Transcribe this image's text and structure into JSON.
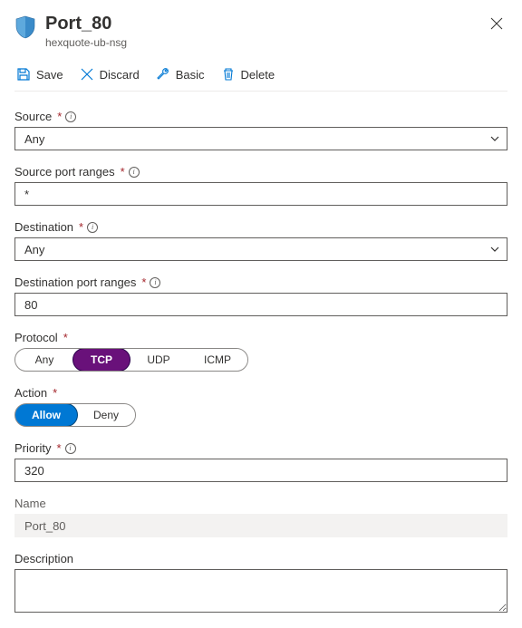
{
  "header": {
    "title": "Port_80",
    "subtitle": "hexquote-ub-nsg"
  },
  "toolbar": {
    "save": "Save",
    "discard": "Discard",
    "basic": "Basic",
    "delete": "Delete"
  },
  "labels": {
    "source": "Source",
    "source_port_ranges": "Source port ranges",
    "destination": "Destination",
    "destination_port_ranges": "Destination port ranges",
    "protocol": "Protocol",
    "action": "Action",
    "priority": "Priority",
    "name": "Name",
    "description": "Description"
  },
  "values": {
    "source": "Any",
    "source_port_ranges": "*",
    "destination": "Any",
    "destination_port_ranges": "80",
    "priority": "320",
    "name": "Port_80",
    "description": ""
  },
  "protocol": {
    "options": [
      "Any",
      "TCP",
      "UDP",
      "ICMP"
    ],
    "selected": "TCP"
  },
  "action": {
    "options": [
      "Allow",
      "Deny"
    ],
    "selected": "Allow"
  }
}
